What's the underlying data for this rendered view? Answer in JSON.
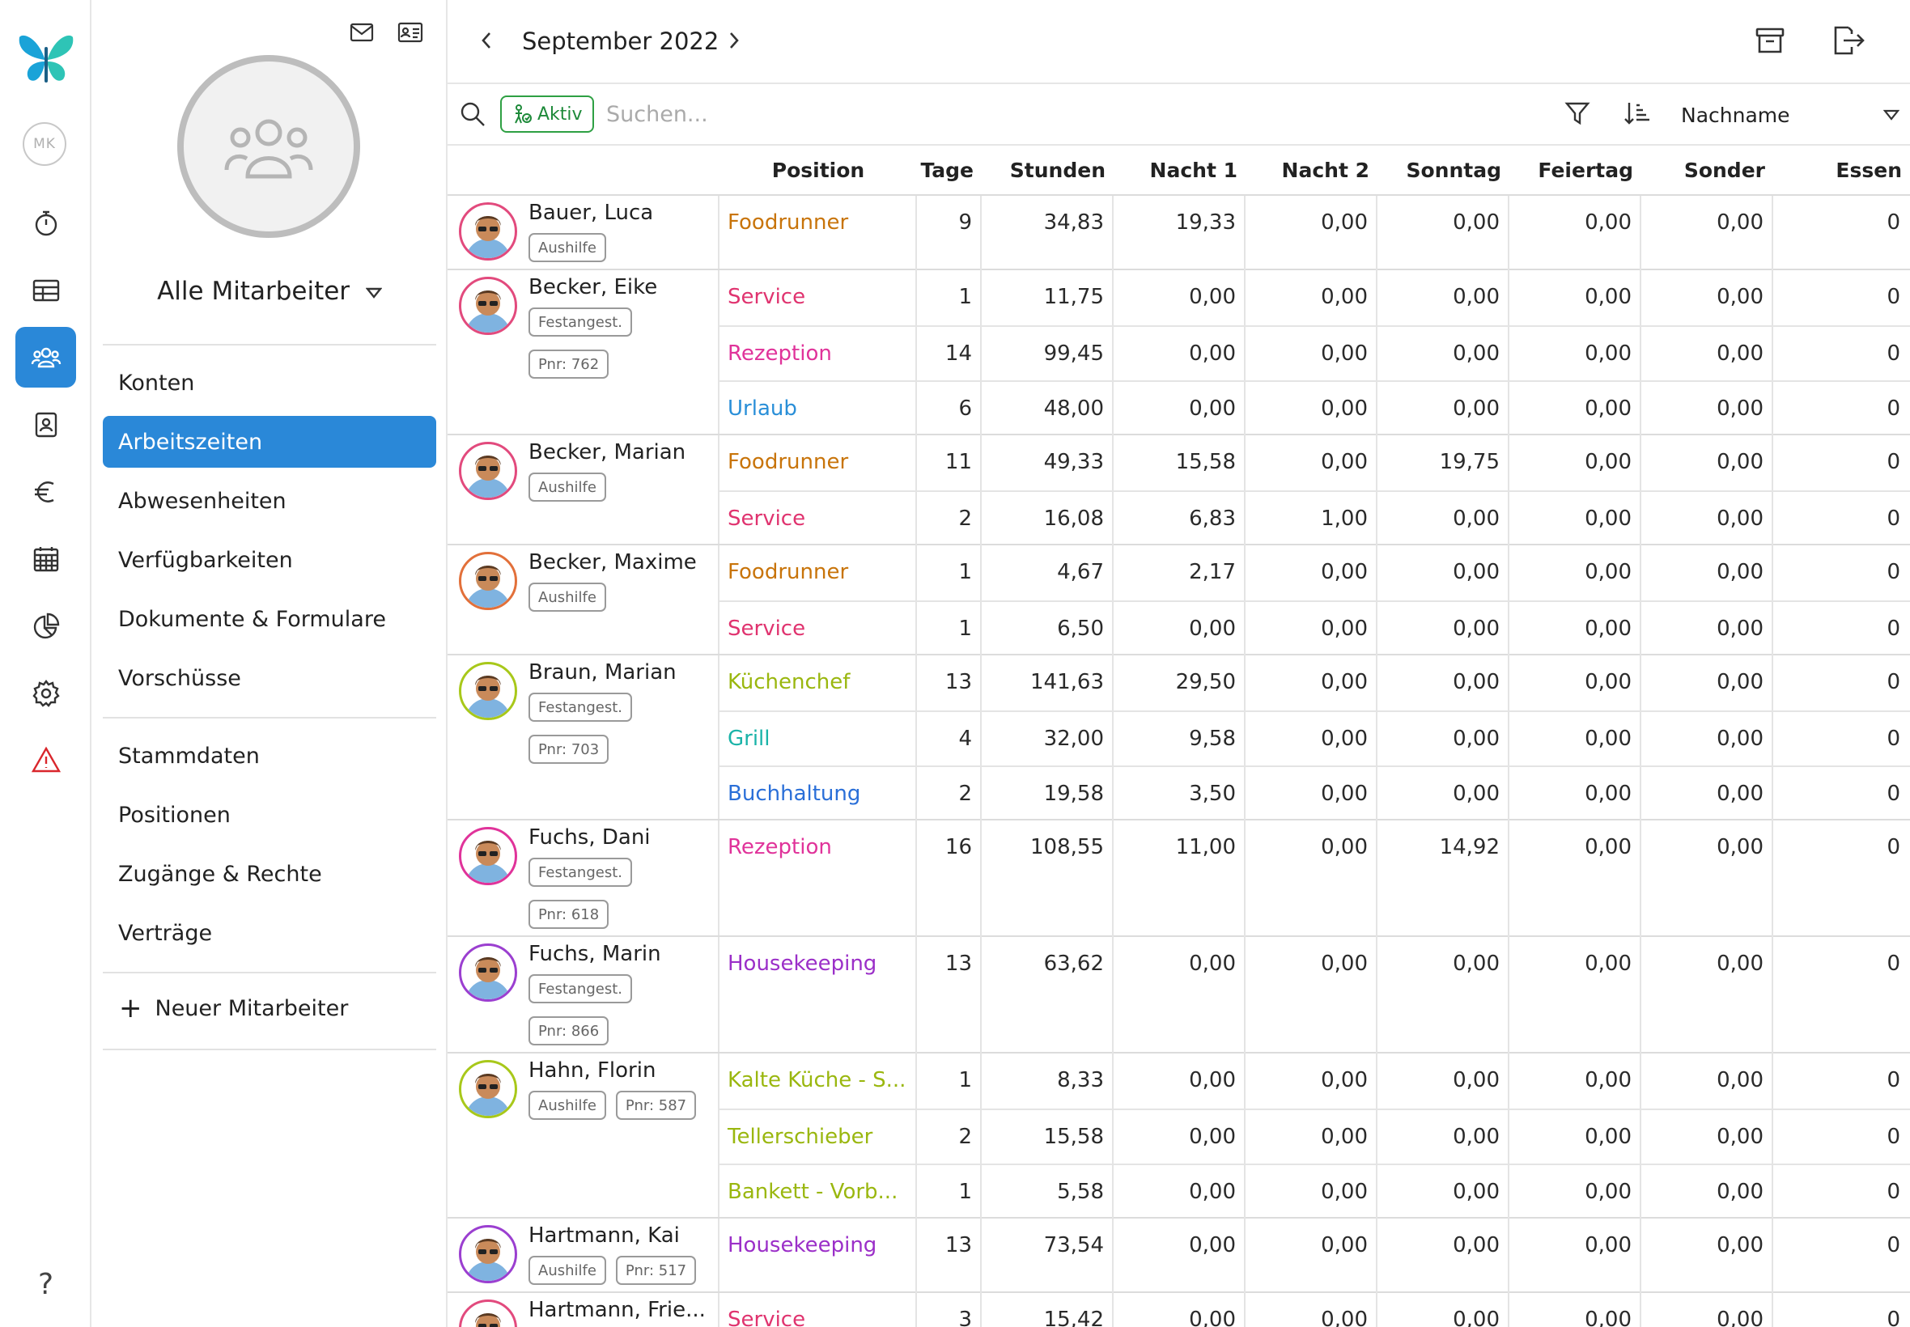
{
  "rail": {
    "user_initials": "MK",
    "items": [
      {
        "icon": "stopwatch-icon"
      },
      {
        "icon": "table-icon"
      },
      {
        "icon": "users-icon",
        "active": true
      },
      {
        "icon": "contact-card-icon"
      },
      {
        "icon": "euro-icon"
      },
      {
        "icon": "calendar-icon"
      },
      {
        "icon": "pie-chart-icon"
      },
      {
        "icon": "gear-icon"
      },
      {
        "icon": "warning-icon"
      }
    ],
    "help": "?"
  },
  "sidebar": {
    "title": "Alle Mitarbeiter",
    "group1": [
      "Konten",
      "Arbeitszeiten",
      "Abwesenheiten",
      "Verfügbarkeiten",
      "Dokumente & Formulare",
      "Vorschüsse"
    ],
    "active": "Arbeitszeiten",
    "group2": [
      "Stammdaten",
      "Positionen",
      "Zugänge & Rechte",
      "Verträge"
    ],
    "new_employee": "Neuer Mitarbeiter"
  },
  "header": {
    "month": "September 2022"
  },
  "filter": {
    "chip": "Aktiv",
    "search_placeholder": "Suchen...",
    "sort": "Nachname"
  },
  "table": {
    "columns": [
      "Position",
      "Tage",
      "Stunden",
      "Nacht 1",
      "Nacht 2",
      "Sonntag",
      "Feiertag",
      "Sonder",
      "Essen"
    ],
    "employees": [
      {
        "name": "Bauer, Luca",
        "tags": [
          "Aushilfe"
        ],
        "ring": "#e24a7d",
        "rows": [
          {
            "position": "Foodrunner",
            "color": "#c8740a",
            "values": [
              "9",
              "34,83",
              "19,33",
              "0,00",
              "0,00",
              "0,00",
              "0,00",
              "0"
            ]
          }
        ]
      },
      {
        "name": "Becker, Eike",
        "tags": [
          "Festangest.",
          "Pnr: 762"
        ],
        "ring": "#e24a7d",
        "rows": [
          {
            "position": "Service",
            "color": "#e0336f",
            "values": [
              "1",
              "11,75",
              "0,00",
              "0,00",
              "0,00",
              "0,00",
              "0,00",
              "0"
            ]
          },
          {
            "position": "Rezeption",
            "color": "#e0339a",
            "values": [
              "14",
              "99,45",
              "0,00",
              "0,00",
              "0,00",
              "0,00",
              "0,00",
              "0"
            ]
          },
          {
            "position": "Urlaub",
            "color": "#2a8fd8",
            "values": [
              "6",
              "48,00",
              "0,00",
              "0,00",
              "0,00",
              "0,00",
              "0,00",
              "0"
            ]
          }
        ]
      },
      {
        "name": "Becker, Marian",
        "tags": [
          "Aushilfe"
        ],
        "ring": "#e24a7d",
        "rows": [
          {
            "position": "Foodrunner",
            "color": "#c8740a",
            "values": [
              "11",
              "49,33",
              "15,58",
              "0,00",
              "19,75",
              "0,00",
              "0,00",
              "0"
            ]
          },
          {
            "position": "Service",
            "color": "#e0336f",
            "values": [
              "2",
              "16,08",
              "6,83",
              "1,00",
              "0,00",
              "0,00",
              "0,00",
              "0"
            ]
          }
        ]
      },
      {
        "name": "Becker, Maxime",
        "tags": [
          "Aushilfe"
        ],
        "ring": "#e2703a",
        "rows": [
          {
            "position": "Foodrunner",
            "color": "#c8740a",
            "values": [
              "1",
              "4,67",
              "2,17",
              "0,00",
              "0,00",
              "0,00",
              "0,00",
              "0"
            ]
          },
          {
            "position": "Service",
            "color": "#e0336f",
            "values": [
              "1",
              "6,50",
              "0,00",
              "0,00",
              "0,00",
              "0,00",
              "0,00",
              "0"
            ]
          }
        ]
      },
      {
        "name": "Braun, Marian",
        "tags": [
          "Festangest.",
          "Pnr: 703"
        ],
        "ring": "#a8c81a",
        "rows": [
          {
            "position": "Küchenchef",
            "color": "#9ab70f",
            "values": [
              "13",
              "141,63",
              "29,50",
              "0,00",
              "0,00",
              "0,00",
              "0,00",
              "0"
            ]
          },
          {
            "position": "Grill",
            "color": "#1ab3a8",
            "values": [
              "4",
              "32,00",
              "9,58",
              "0,00",
              "0,00",
              "0,00",
              "0,00",
              "0"
            ]
          },
          {
            "position": "Buchhaltung",
            "color": "#2a6fd8",
            "values": [
              "2",
              "19,58",
              "3,50",
              "0,00",
              "0,00",
              "0,00",
              "0,00",
              "0"
            ]
          }
        ]
      },
      {
        "name": "Fuchs, Dani",
        "tags": [
          "Festangest.",
          "Pnr: 618"
        ],
        "ring": "#e0339a",
        "rows": [
          {
            "position": "Rezeption",
            "color": "#e0339a",
            "values": [
              "16",
              "108,55",
              "11,00",
              "0,00",
              "14,92",
              "0,00",
              "0,00",
              "0"
            ]
          }
        ]
      },
      {
        "name": "Fuchs, Marin",
        "tags": [
          "Festangest.",
          "Pnr: 866"
        ],
        "ring": "#9b3fd0",
        "rows": [
          {
            "position": "Housekeeping",
            "color": "#9b2fc8",
            "values": [
              "13",
              "63,62",
              "0,00",
              "0,00",
              "0,00",
              "0,00",
              "0,00",
              "0"
            ]
          }
        ]
      },
      {
        "name": "Hahn, Florin",
        "tags": [
          "Aushilfe",
          "Pnr: 587"
        ],
        "ring": "#a8c81a",
        "rows": [
          {
            "position": "Kalte Küche - S...",
            "color": "#9ab70f",
            "values": [
              "1",
              "8,33",
              "0,00",
              "0,00",
              "0,00",
              "0,00",
              "0,00",
              "0"
            ]
          },
          {
            "position": "Tellerschieber",
            "color": "#9ab70f",
            "values": [
              "2",
              "15,58",
              "0,00",
              "0,00",
              "0,00",
              "0,00",
              "0,00",
              "0"
            ]
          },
          {
            "position": "Bankett - Vorb...",
            "color": "#9ab70f",
            "values": [
              "1",
              "5,58",
              "0,00",
              "0,00",
              "0,00",
              "0,00",
              "0,00",
              "0"
            ]
          }
        ]
      },
      {
        "name": "Hartmann, Kai",
        "tags": [
          "Aushilfe",
          "Pnr: 517"
        ],
        "ring": "#9b3fd0",
        "rows": [
          {
            "position": "Housekeeping",
            "color": "#9b2fc8",
            "values": [
              "13",
              "73,54",
              "0,00",
              "0,00",
              "0,00",
              "0,00",
              "0,00",
              "0"
            ]
          }
        ]
      },
      {
        "name": "Hartmann, Frie...",
        "tags": [],
        "ring": "#e24a7d",
        "rows": [
          {
            "position": "Service",
            "color": "#e0336f",
            "values": [
              "3",
              "15,42",
              "0,00",
              "0,00",
              "0,00",
              "0,00",
              "0,00",
              "0"
            ]
          }
        ]
      }
    ]
  }
}
